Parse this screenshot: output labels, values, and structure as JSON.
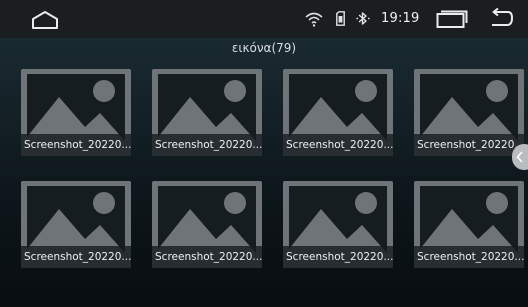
{
  "status_bar": {
    "time": "19:19",
    "icons": [
      "home-icon",
      "wifi-icon",
      "sim-card-icon",
      "bluetooth-icon",
      "recent-apps-icon",
      "back-icon"
    ]
  },
  "gallery": {
    "title": "εικόνα(79)",
    "items": [
      {
        "label": "Screenshot_20220",
        "ellipsis": "..."
      },
      {
        "label": "Screenshot_20220",
        "ellipsis": "..."
      },
      {
        "label": "Screenshot_20220",
        "ellipsis": "..."
      },
      {
        "label": "Screenshot_20220",
        "ellipsis": "..."
      },
      {
        "label": "Screenshot_20220",
        "ellipsis": "..."
      },
      {
        "label": "Screenshot_20220",
        "ellipsis": "..."
      },
      {
        "label": "Screenshot_20220",
        "ellipsis": "..."
      },
      {
        "label": "Screenshot_20220",
        "ellipsis": "..."
      }
    ]
  },
  "colors": {
    "status_bar_bg": "#1b1e21",
    "placeholder_fill": "#6f7478",
    "background_top": "#21343d",
    "background_bottom": "#080d10"
  }
}
